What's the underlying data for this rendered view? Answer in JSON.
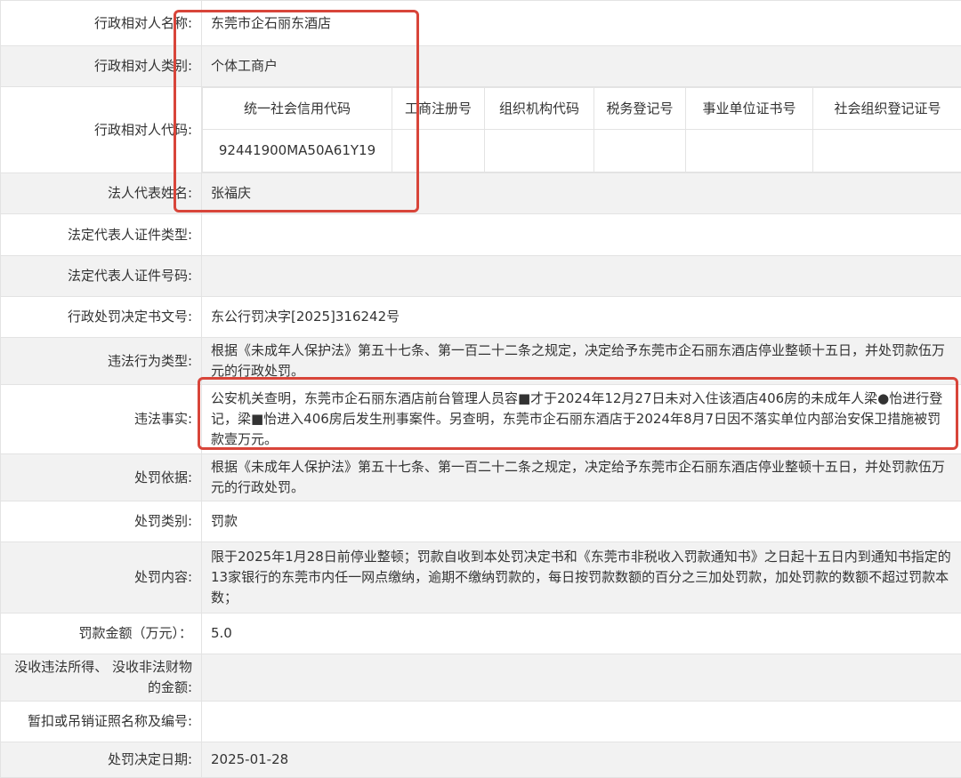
{
  "rows": {
    "name": {
      "label": "行政相对人名称:",
      "value": "东莞市企石丽东酒店"
    },
    "category": {
      "label": "行政相对人类别:",
      "value": "个体工商户"
    },
    "code": {
      "label": "行政相对人代码:",
      "headers": [
        "统一社会信用代码",
        "工商注册号",
        "组织机构代码",
        "税务登记号",
        "事业单位证书号",
        "社会组织登记证号"
      ],
      "values": [
        "92441900MA50A61Y19",
        "",
        "",
        "",
        "",
        ""
      ]
    },
    "legal_rep": {
      "label": "法人代表姓名:",
      "value": "张福庆"
    },
    "id_type": {
      "label": "法定代表人证件类型:",
      "value": ""
    },
    "id_number": {
      "label": "法定代表人证件号码:",
      "value": ""
    },
    "decision_no": {
      "label": "行政处罚决定书文号:",
      "value": "东公行罚决字[2025]316242号"
    },
    "violation_type": {
      "label": "违法行为类型:",
      "value": "根据《未成年人保护法》第五十七条、第一百二十二条之规定，决定给予东莞市企石丽东酒店停业整顿十五日，并处罚款伍万元的行政处罚。"
    },
    "facts": {
      "label": "违法事实:",
      "value": "公安机关查明，东莞市企石丽东酒店前台管理人员容■才于2024年12月27日未对入住该酒店406房的未成年人梁●怡进行登记，梁■怡进入406房后发生刑事案件。另查明，东莞市企石丽东酒店于2024年8月7日因不落实单位内部治安保卫措施被罚款壹万元。"
    },
    "basis": {
      "label": "处罚依据:",
      "value": "根据《未成年人保护法》第五十七条、第一百二十二条之规定，决定给予东莞市企石丽东酒店停业整顿十五日，并处罚款伍万元的行政处罚。"
    },
    "penalty_type": {
      "label": "处罚类别:",
      "value": "罚款"
    },
    "penalty_content": {
      "label": "处罚内容:",
      "value": "限于2025年1月28日前停业整顿；罚款自收到本处罚决定书和《东莞市非税收入罚款通知书》之日起十五日内到通知书指定的13家银行的东莞市内任一网点缴纳，逾期不缴纳罚款的，每日按罚款数额的百分之三加处罚款，加处罚款的数额不超过罚款本数；"
    },
    "amount": {
      "label": "罚款金额（万元）：",
      "value": "5.0"
    },
    "confiscation": {
      "label": "没收违法所得、 没收非法财物的金额:",
      "value": ""
    },
    "license": {
      "label": "暂扣或吊销证照名称及编号:",
      "value": ""
    },
    "decision_date": {
      "label": "处罚决定日期:",
      "value": "2025-01-28"
    }
  }
}
